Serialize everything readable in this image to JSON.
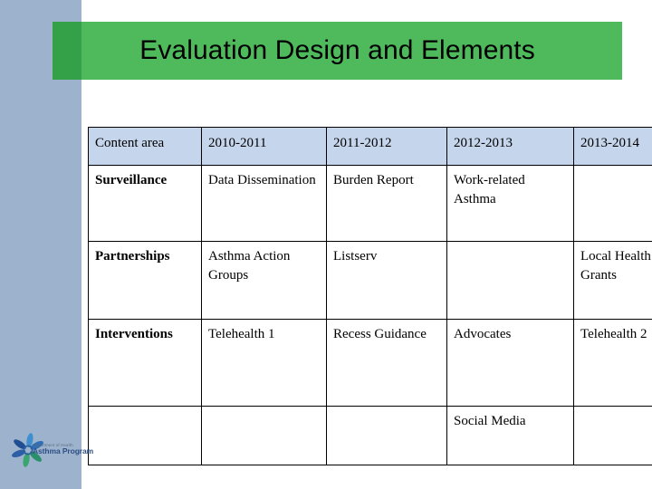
{
  "slide": {
    "title": "Evaluation Design and Elements",
    "colors": {
      "sidebar": "#9db2cd",
      "banner": "#4fba5c",
      "banner_overlap": "#34a048",
      "table_header": "#c4d5ec",
      "table_border": "#000000",
      "background": "#ffffff"
    }
  },
  "table": {
    "columns": [
      "Content area",
      "2010-2011",
      "2011-2012",
      "2012-2013",
      "2013-2014"
    ],
    "rows": [
      {
        "label": "Surveillance",
        "cells": [
          "Data Dissemination",
          "Burden Report",
          "Work-related Asthma",
          ""
        ]
      },
      {
        "label": "Partnerships",
        "cells": [
          "Asthma Action Groups",
          "Listserv",
          "",
          "Local Health District Grants"
        ]
      },
      {
        "label": "Interventions",
        "cells": [
          "Telehealth 1",
          "Recess Guidance",
          "Advocates",
          "Telehealth 2"
        ]
      },
      {
        "label": "",
        "cells": [
          "",
          "",
          "Social Media",
          ""
        ]
      }
    ]
  },
  "logo": {
    "org_line": "Department of Health",
    "program_line": "Asthma Program"
  }
}
